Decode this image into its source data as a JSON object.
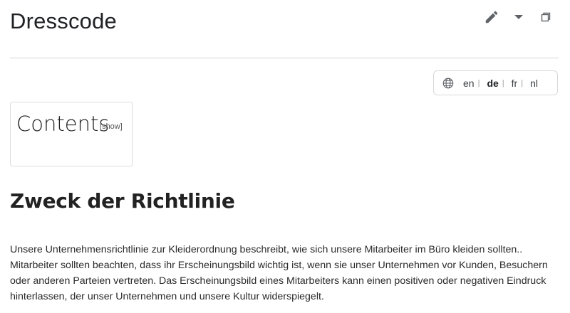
{
  "page": {
    "title": "Dresscode"
  },
  "actions": {
    "edit_icon": "pencil-icon",
    "menu_icon": "caret-down-icon",
    "window_icon": "restore-window-icon"
  },
  "languages": {
    "items": [
      {
        "code": "en",
        "active": false
      },
      {
        "code": "de",
        "active": true
      },
      {
        "code": "fr",
        "active": false
      },
      {
        "code": "nl",
        "active": false
      }
    ],
    "separator": "|"
  },
  "toc": {
    "title": "Contents",
    "bracket_open": "[",
    "toggle_label": "show",
    "bracket_close": "]"
  },
  "section": {
    "heading": "Zweck der Richtlinie",
    "paragraph": "Unsere Unternehmensrichtlinie zur Kleiderordnung beschreibt, wie sich unsere Mitarbeiter im Büro kleiden sollten.. Mitarbeiter sollten beachten, dass ihr Erscheinungsbild wichtig ist, wenn sie unser Unternehmen vor Kunden, Besuchern oder anderen Parteien vertreten. Das Erscheinungsbild eines Mitarbeiters kann einen positiven oder negativen Eindruck hinterlassen, der unser Unternehmen und unsere Kultur widerspiegelt."
  },
  "colors": {
    "text": "#222222",
    "icon": "#5f6368",
    "border": "#d8d8d8"
  }
}
